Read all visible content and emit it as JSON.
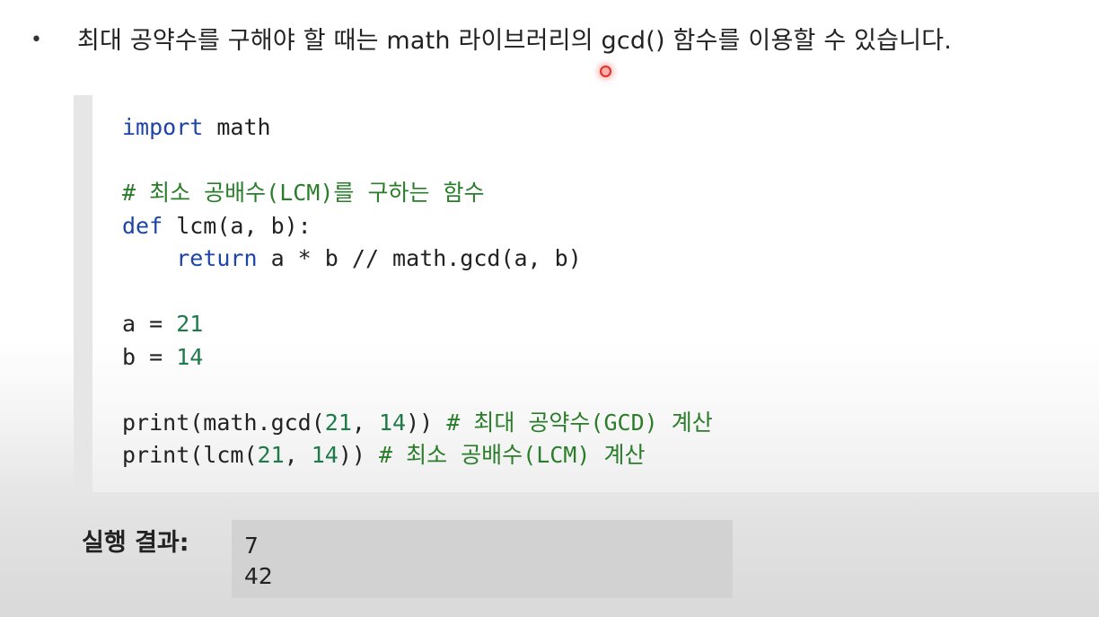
{
  "bullet": {
    "marker": "•",
    "text": "최대 공약수를 구해야 할 때는 math 라이브러리의 gcd() 함수를 이용할 수 있습니다."
  },
  "code": {
    "line1": {
      "keyword": "import",
      "rest": " math"
    },
    "line3": {
      "comment": "# 최소 공배수(LCM)를 구하는 함수"
    },
    "line4": {
      "keyword": "def",
      "rest": " lcm(a, b):"
    },
    "line5": {
      "indent": "    ",
      "keyword": "return",
      "rest": " a * b // math.gcd(a, b)"
    },
    "line7": {
      "text": "a = ",
      "number": "21"
    },
    "line8": {
      "text": "b = ",
      "number": "14"
    },
    "line10": {
      "pre": "print(math.gcd(",
      "n1": "21",
      "sep": ", ",
      "n2": "14",
      "post": ")) ",
      "comment": "# 최대 공약수(GCD) 계산"
    },
    "line11": {
      "pre": "print(lcm(",
      "n1": "21",
      "sep": ", ",
      "n2": "14",
      "post": ")) ",
      "comment": "# 최소 공배수(LCM) 계산"
    }
  },
  "result": {
    "label": "실행 결과:",
    "lines": [
      "7",
      "42"
    ]
  },
  "colors": {
    "keyword": "#1e44a6",
    "comment": "#2a7d2a",
    "number": "#1f7a4a",
    "cursor": "#e0302c"
  }
}
